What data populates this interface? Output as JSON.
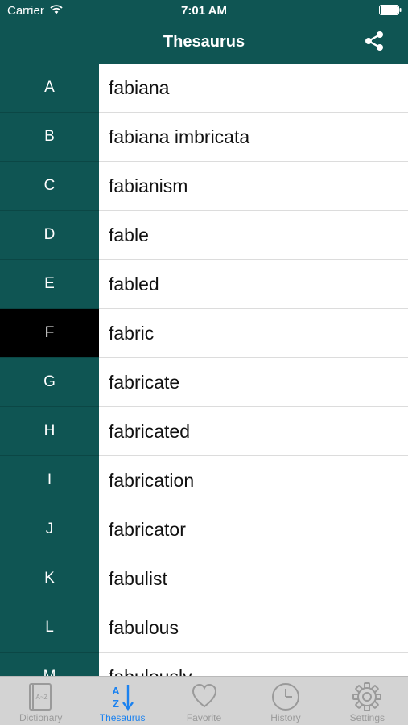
{
  "status_bar": {
    "carrier": "Carrier",
    "time": "7:01 AM"
  },
  "nav": {
    "title": "Thesaurus"
  },
  "index_letters": [
    "A",
    "B",
    "C",
    "D",
    "E",
    "F",
    "G",
    "H",
    "I",
    "J",
    "K",
    "L",
    "M"
  ],
  "active_letter": "F",
  "words": [
    "fabiana",
    "fabiana imbricata",
    "fabianism",
    "fable",
    "fabled",
    "fabric",
    "fabricate",
    "fabricated",
    "fabrication",
    "fabricator",
    "fabulist",
    "fabulous",
    "fabulously"
  ],
  "tabs": [
    {
      "label": "Dictionary",
      "icon": "dictionary-book-icon",
      "active": false
    },
    {
      "label": "Thesaurus",
      "icon": "az-sort-icon",
      "active": true
    },
    {
      "label": "Favorite",
      "icon": "heart-icon",
      "active": false
    },
    {
      "label": "History",
      "icon": "clock-icon",
      "active": false
    },
    {
      "label": "Settings",
      "icon": "gear-icon",
      "active": false
    }
  ],
  "colors": {
    "header_bg": "#0f5553",
    "active_letter_bg": "#000000",
    "tab_active": "#1b82f0",
    "tab_inactive": "#9a9a9a"
  }
}
